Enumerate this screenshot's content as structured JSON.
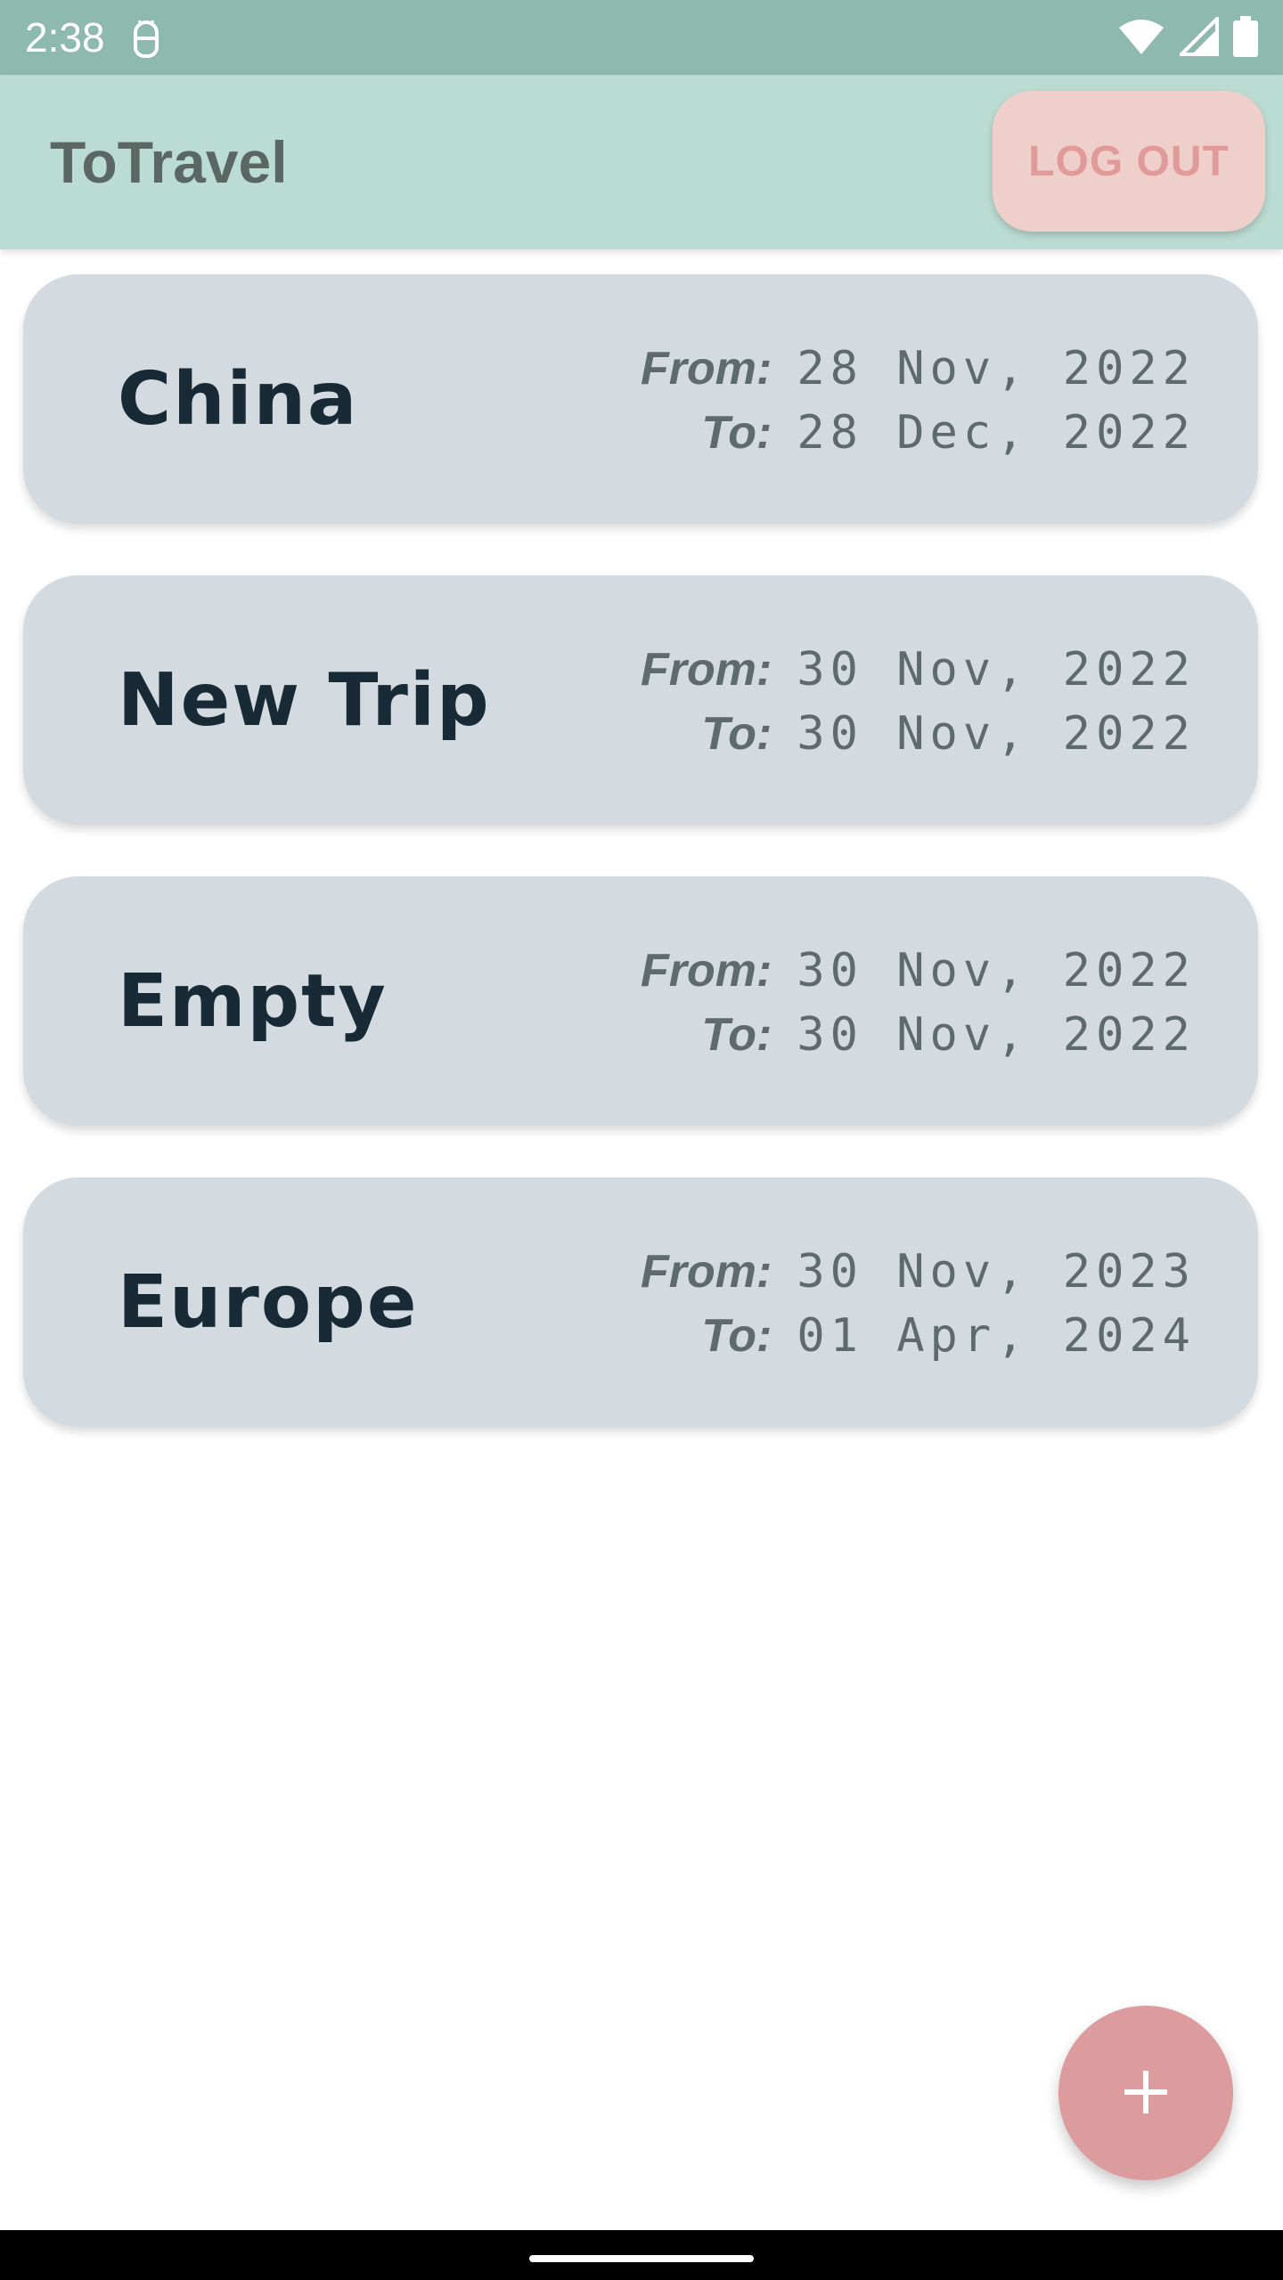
{
  "status_bar": {
    "time": "2:38",
    "icons": [
      "android-debug-icon",
      "wifi-icon",
      "signal-icon",
      "battery-icon"
    ]
  },
  "app_bar": {
    "title": "ToTravel",
    "logout_label": "LOG OUT"
  },
  "trips": [
    {
      "name": "China",
      "from_label": "From:",
      "from": "28 Nov, 2022",
      "to_label": "To:",
      "to": "28 Dec, 2022"
    },
    {
      "name": "New Trip",
      "from_label": "From:",
      "from": "30 Nov, 2022",
      "to_label": "To:",
      "to": "30 Nov, 2022"
    },
    {
      "name": "Empty",
      "from_label": "From:",
      "from": "30 Nov, 2022",
      "to_label": "To:",
      "to": "30 Nov, 2022"
    },
    {
      "name": "Europe",
      "from_label": "From:",
      "from": "30 Nov, 2023",
      "to_label": "To:",
      "to": "01 Apr, 2024"
    }
  ],
  "fab": {
    "icon": "plus-icon"
  },
  "colors": {
    "status_bar": "#8dbaad",
    "app_bar": "#bbdcd2",
    "card": "#d3dbe0",
    "logout_bg": "#efcfca",
    "logout_text": "#e09a9a",
    "fab": "#dc9b9d"
  }
}
